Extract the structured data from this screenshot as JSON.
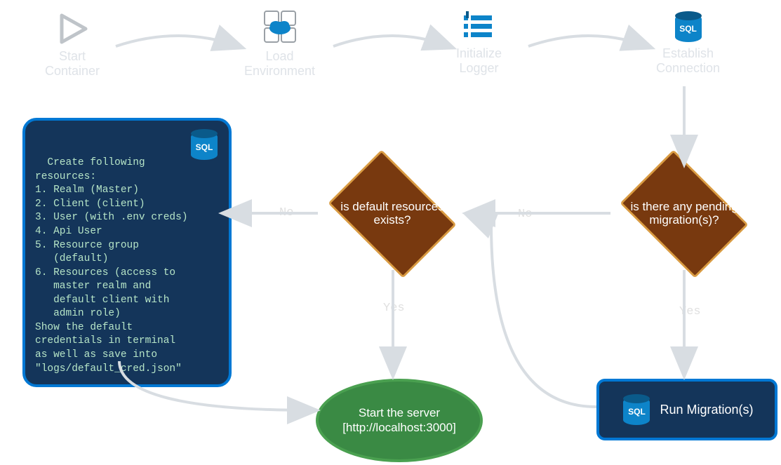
{
  "nodes": {
    "start_container": {
      "label1": "Start",
      "label2": "Container"
    },
    "load_env": {
      "label1": "Load",
      "label2": "Environment"
    },
    "init_logger": {
      "label1": "Initialize",
      "label2": "Logger"
    },
    "establish_conn": {
      "label1": "Establish",
      "label2": "Connection",
      "icon_text": "SQL"
    },
    "decision_migrations": {
      "text": "is there any pending migration(s)?"
    },
    "decision_resources": {
      "text": "is default resources exists?"
    },
    "run_migrations": {
      "text": "Run Migration(s)",
      "icon_text": "SQL"
    },
    "start_server": {
      "line1": "Start the server",
      "line2": "[http://localhost:3000]"
    },
    "create_resources": {
      "body": "Create following\nresources:\n1. Realm (Master)\n2. Client (client)\n3. User (with .env creds)\n4. Api User\n5. Resource group\n   (default)\n6. Resources (access to\n   master realm and\n   default client with\n   admin role)\nShow the default\ncredentials in terminal\nas well as save into\n\"logs/default_cred.json\"",
      "icon_text": "SQL"
    }
  },
  "edge_labels": {
    "migrations_yes": "Yes",
    "migrations_no": "No",
    "resources_yes": "Yes",
    "resources_no": "No"
  },
  "chart_data": {
    "type": "flowchart",
    "nodes": [
      {
        "id": "start_container",
        "kind": "process",
        "label": "Start Container"
      },
      {
        "id": "load_env",
        "kind": "process",
        "label": "Load Environment"
      },
      {
        "id": "init_logger",
        "kind": "process",
        "label": "Initialize Logger"
      },
      {
        "id": "establish_conn",
        "kind": "process",
        "label": "Establish Connection"
      },
      {
        "id": "decision_migrations",
        "kind": "decision",
        "label": "is there any pending migration(s)?"
      },
      {
        "id": "run_migrations",
        "kind": "process",
        "label": "Run Migration(s)"
      },
      {
        "id": "decision_resources",
        "kind": "decision",
        "label": "is default resources exists?"
      },
      {
        "id": "create_resources",
        "kind": "process",
        "label": "Create following resources: 1. Realm (Master) 2. Client (client) 3. User (with .env creds) 4. Api User 5. Resource group (default) 6. Resources (access to master realm and default client with admin role). Show the default credentials in terminal as well as save into \"logs/default_cred.json\""
      },
      {
        "id": "start_server",
        "kind": "terminator",
        "label": "Start the server [http://localhost:3000]"
      }
    ],
    "edges": [
      {
        "from": "start_container",
        "to": "load_env"
      },
      {
        "from": "load_env",
        "to": "init_logger"
      },
      {
        "from": "init_logger",
        "to": "establish_conn"
      },
      {
        "from": "establish_conn",
        "to": "decision_migrations"
      },
      {
        "from": "decision_migrations",
        "to": "run_migrations",
        "label": "Yes"
      },
      {
        "from": "decision_migrations",
        "to": "decision_resources",
        "label": "No"
      },
      {
        "from": "run_migrations",
        "to": "decision_resources"
      },
      {
        "from": "decision_resources",
        "to": "start_server",
        "label": "Yes"
      },
      {
        "from": "decision_resources",
        "to": "create_resources",
        "label": "No"
      },
      {
        "from": "create_resources",
        "to": "start_server"
      }
    ]
  }
}
